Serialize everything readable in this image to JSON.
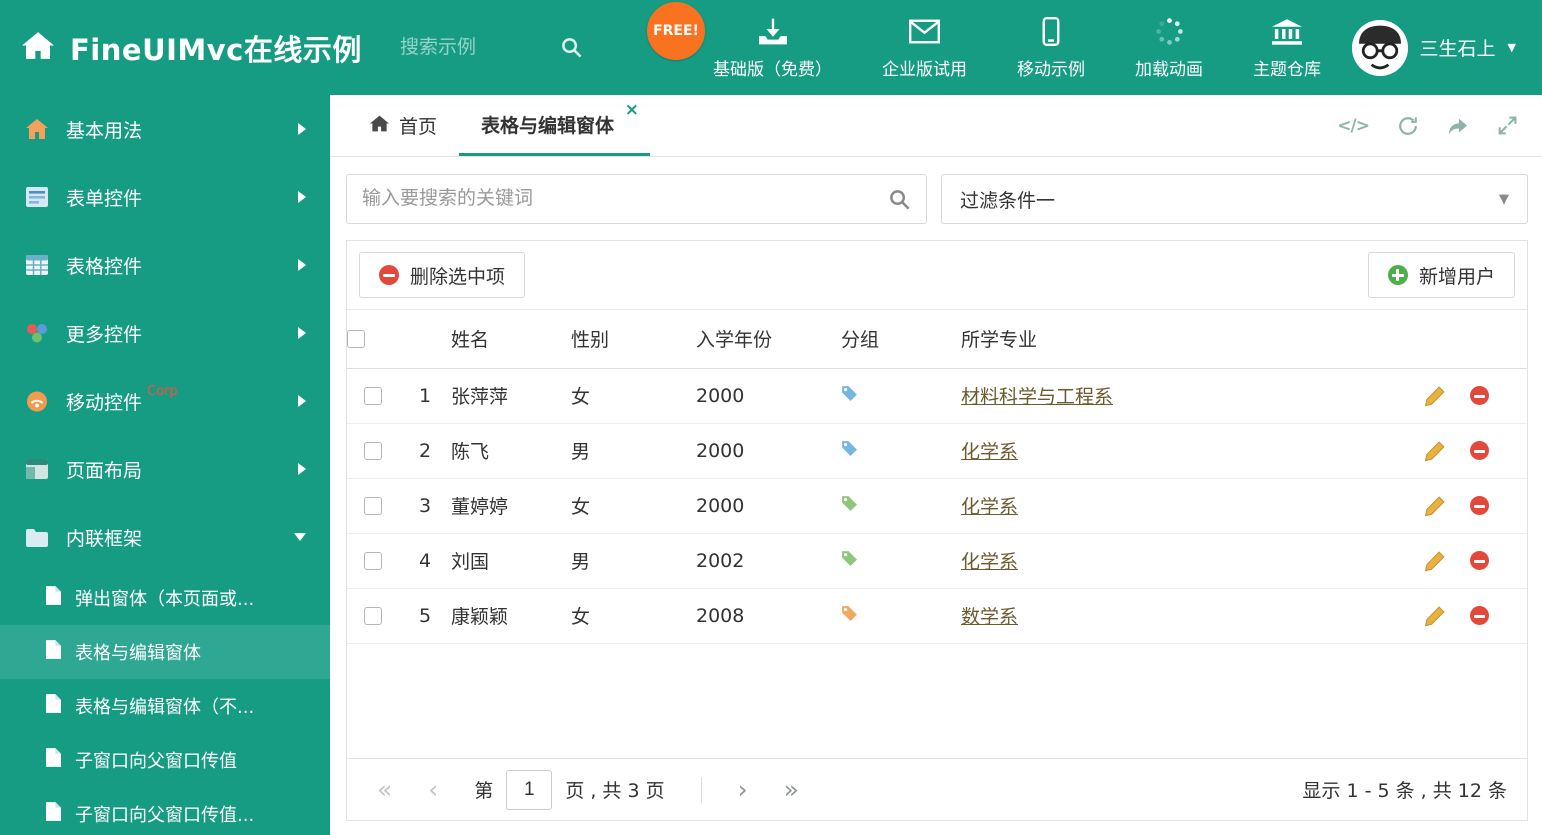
{
  "header": {
    "title": "FineUIMvc在线示例",
    "search_placeholder": "搜索示例",
    "free_badge": "FREE!",
    "nav": [
      {
        "label": "基础版（免费）"
      },
      {
        "label": "企业版试用"
      },
      {
        "label": "移动示例"
      },
      {
        "label": "加载动画"
      },
      {
        "label": "主题仓库"
      }
    ],
    "user_name": "三生石上"
  },
  "sidebar": {
    "items": [
      {
        "label": "基本用法"
      },
      {
        "label": "表单控件"
      },
      {
        "label": "表格控件"
      },
      {
        "label": "更多控件"
      },
      {
        "label": "移动控件",
        "badge": "Corp"
      },
      {
        "label": "页面布局"
      },
      {
        "label": "内联框架"
      }
    ],
    "subitems": [
      {
        "label": "弹出窗体（本页面或..."
      },
      {
        "label": "表格与编辑窗体"
      },
      {
        "label": "表格与编辑窗体（不..."
      },
      {
        "label": "子窗口向父窗口传值"
      },
      {
        "label": "子窗口向父窗口传值..."
      }
    ]
  },
  "tabs": {
    "home": "首页",
    "active": "表格与编辑窗体"
  },
  "icons": {
    "close": "×",
    "caret_down": "▼",
    "code": "</>"
  },
  "filters": {
    "search_placeholder": "输入要搜索的关键词",
    "filter_value": "过滤条件一"
  },
  "toolbar": {
    "delete_label": "删除选中项",
    "add_label": "新增用户"
  },
  "table": {
    "headers": {
      "name": "姓名",
      "gender": "性别",
      "year": "入学年份",
      "group": "分组",
      "major": "所学专业"
    },
    "rows": [
      {
        "num": "1",
        "name": "张萍萍",
        "gender": "女",
        "year": "2000",
        "tag_color": "#76b6e0",
        "major": "材料科学与工程系"
      },
      {
        "num": "2",
        "name": "陈飞",
        "gender": "男",
        "year": "2000",
        "tag_color": "#76b6e0",
        "major": "化学系"
      },
      {
        "num": "3",
        "name": "董婷婷",
        "gender": "女",
        "year": "2000",
        "tag_color": "#90c67c",
        "major": "化学系"
      },
      {
        "num": "4",
        "name": "刘国",
        "gender": "男",
        "year": "2002",
        "tag_color": "#90c67c",
        "major": "化学系"
      },
      {
        "num": "5",
        "name": "康颖颖",
        "gender": "女",
        "year": "2008",
        "tag_color": "#f0aa60",
        "major": "数学系"
      }
    ]
  },
  "pagination": {
    "first": "«",
    "prev": "‹",
    "page_prefix": "第",
    "page_value": "1",
    "page_suffix": "页 , 共 3 页",
    "next": "›",
    "last": "»",
    "summary": "显示 1 - 5 条 , 共 12 条"
  },
  "colors": {
    "theme": "#179c84",
    "sidebar_active": "#2fa893",
    "free_badge": "#f8721f",
    "danger": "#e2493b",
    "success": "#4fae4c",
    "pencil": "#e9b23f",
    "link": "#6b5b2e",
    "tool_icon": "#8fb3ab"
  }
}
